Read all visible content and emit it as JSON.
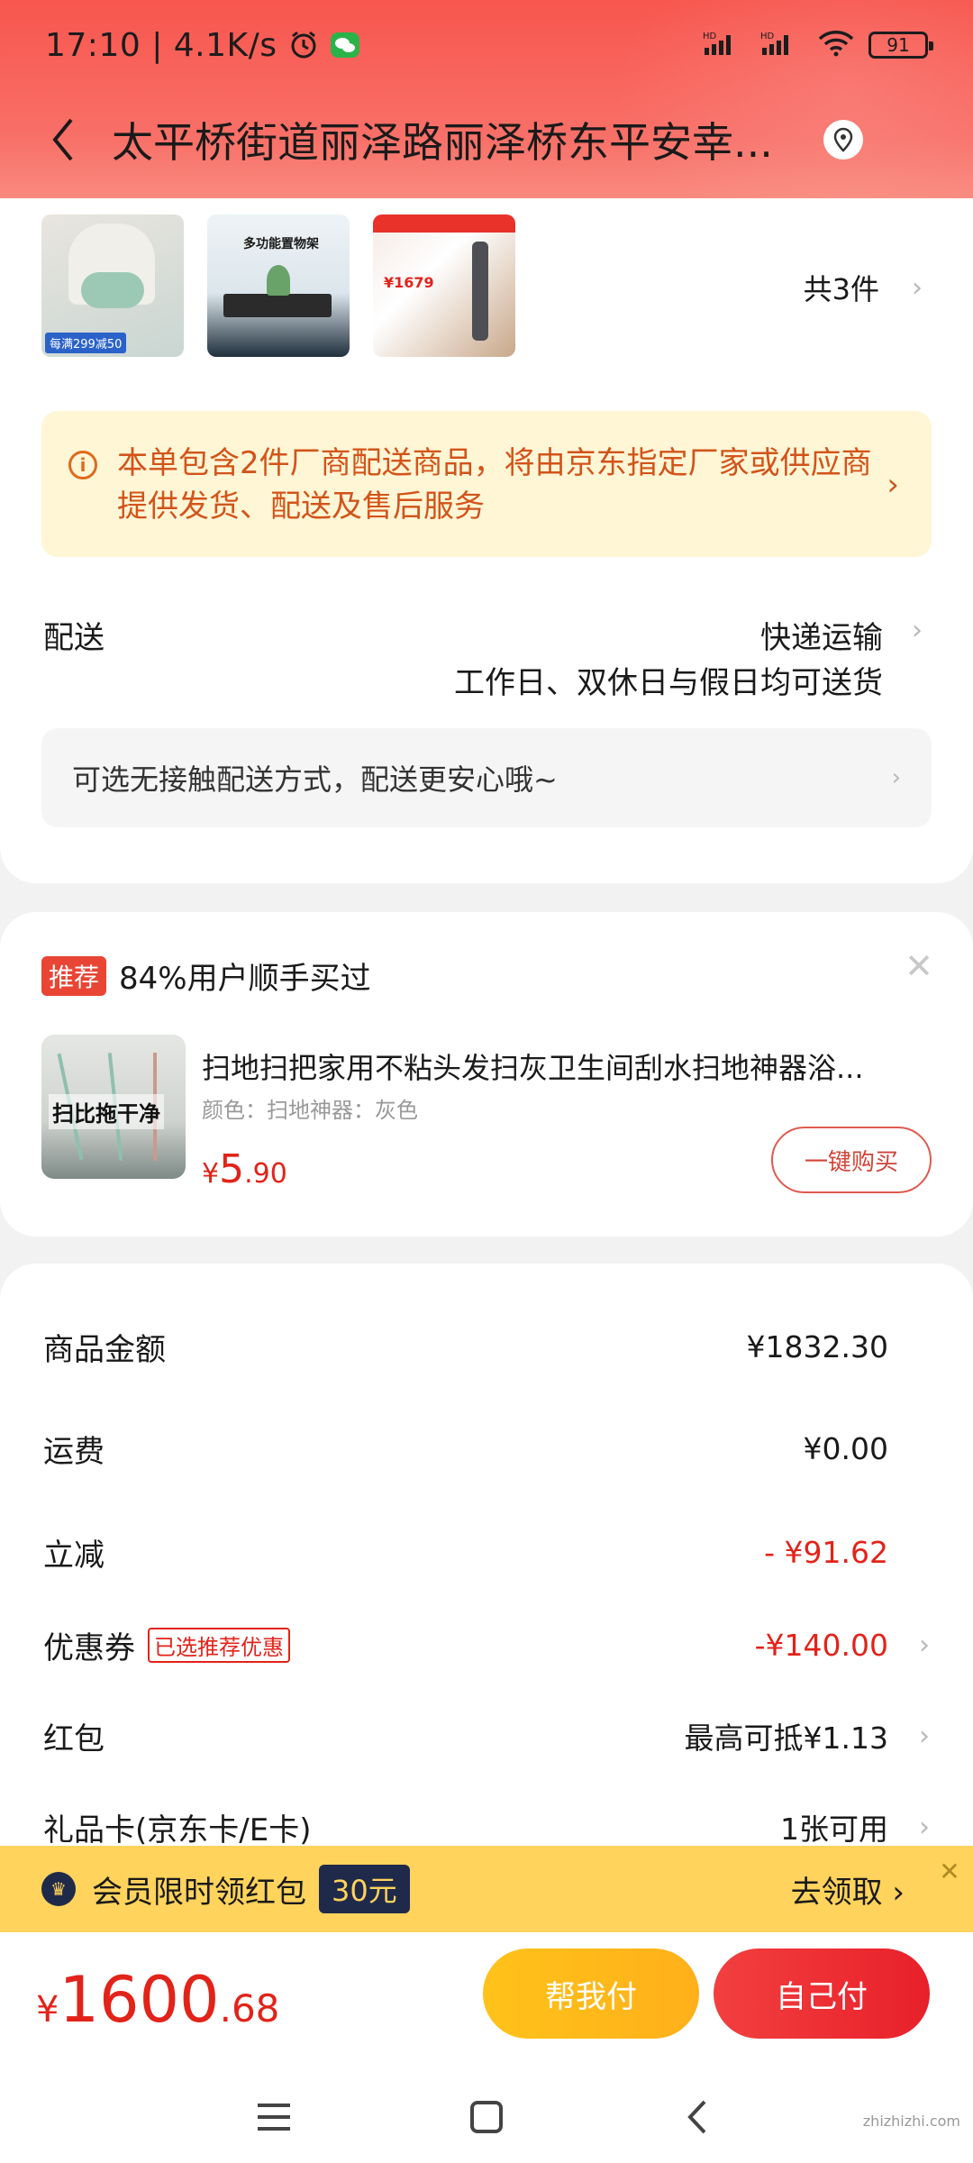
{
  "status_bar": {
    "time": "17:10 | 4.1K/s",
    "battery": "91"
  },
  "header": {
    "address": "太平桥街道丽泽路丽泽桥东平安幸..."
  },
  "items": {
    "count_label": "共3件",
    "thumb2_text": "多功能置物架",
    "thumb1_tag": "每满299减50",
    "thumb3_price": "¥1679"
  },
  "notice": {
    "text": "本单包含2件厂商配送商品，将由京东指定厂家或供应商提供发货、配送及售后服务"
  },
  "delivery": {
    "label": "配送",
    "method": "快递运输",
    "time": "工作日、双休日与假日均可送货",
    "contactless": "可选无接触配送方式，配送更安心哦~"
  },
  "recommend": {
    "badge": "推荐",
    "title": "84%用户顺手买过",
    "product_name": "扫地扫把家用不粘头发扫灰卫生间刮水扫地神器浴...",
    "spec": "颜色：扫地神器：灰色",
    "image_text": "扫比拖干净",
    "price_symbol": "¥",
    "price_int": "5",
    "price_dec": ".90",
    "buy_label": "一键购买"
  },
  "summary": {
    "rows": [
      {
        "label": "商品金额",
        "value": "¥1832.30"
      },
      {
        "label": "运费",
        "value": "¥0.00"
      },
      {
        "label": "立减",
        "value": "- ¥91.62"
      },
      {
        "label": "优惠券",
        "tag": "已选推荐优惠",
        "value": "-¥140.00"
      },
      {
        "label": "红包",
        "value": "最高可抵¥1.13"
      },
      {
        "label": "礼品卡(京东卡/E卡)",
        "value": "1张可用"
      }
    ]
  },
  "banner": {
    "text": "会员限时领红包",
    "amount": "30元",
    "link": "去领取"
  },
  "bottom": {
    "total_symbol": "¥",
    "total_int": "1600",
    "total_dec": ".68",
    "help_pay": "帮我付",
    "self_pay": "自己付",
    "watermark": "zhizhizhi.com"
  }
}
